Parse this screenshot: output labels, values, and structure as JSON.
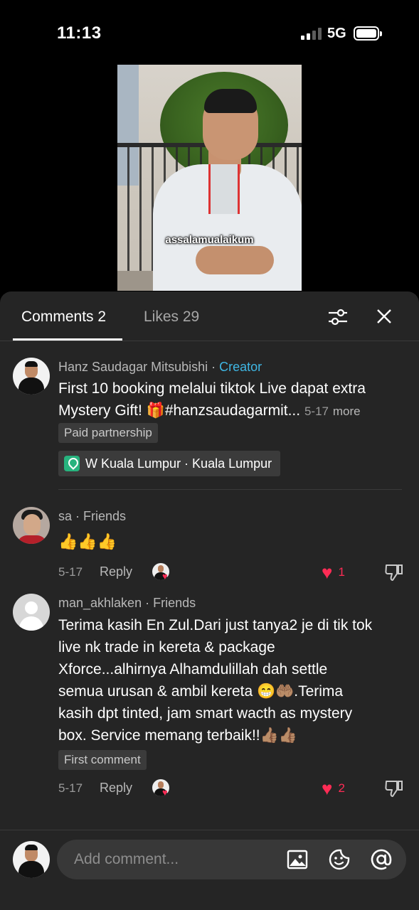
{
  "status_bar": {
    "time": "11:13",
    "network": "5G"
  },
  "video": {
    "caption": "assalamualaikum"
  },
  "tabs": [
    {
      "label": "Comments 2",
      "active": true
    },
    {
      "label": "Likes 29",
      "active": false
    }
  ],
  "comments": [
    {
      "user": "Hanz Saudagar Mitsubishi",
      "badge": "Creator",
      "text_line1": "First 10 booking melalui tiktok Live dapat extra",
      "text_line2": "Mystery Gift! 🎁#hanzsaudagarmit...",
      "date": "5-17",
      "more": "more",
      "chip": "Paid partnership",
      "location": "W Kuala Lumpur · Kuala Lumpur"
    },
    {
      "user": "sa",
      "badge": "Friends",
      "text": "👍👍👍",
      "date": "5-17",
      "reply": "Reply",
      "likes": "1"
    },
    {
      "user": "man_akhlaken",
      "badge": "Friends",
      "lines": [
        "Terima kasih En Zul.Dari just tanya2 je di tik tok",
        "live nk trade in kereta & package",
        "Xforce...alhirnya Alhamdulillah dah settle",
        "semua urusan & ambil kereta 😁🤲🏽.Terima",
        "kasih dpt tinted, jam smart wacth as mystery",
        "box. Service memang terbaik!!👍🏽👍🏽"
      ],
      "chip": "First comment",
      "date": "5-17",
      "reply": "Reply",
      "likes": "2"
    }
  ],
  "input": {
    "placeholder": "Add comment..."
  },
  "colors": {
    "accent_like": "#fe2c55",
    "creator_tag": "#3fb7e4",
    "sheet_bg": "#252525"
  },
  "icons": [
    "filter-icon",
    "close-icon",
    "location-pin-icon",
    "heart-icon",
    "dislike-icon",
    "image-icon",
    "sticker-icon",
    "mention-icon"
  ]
}
